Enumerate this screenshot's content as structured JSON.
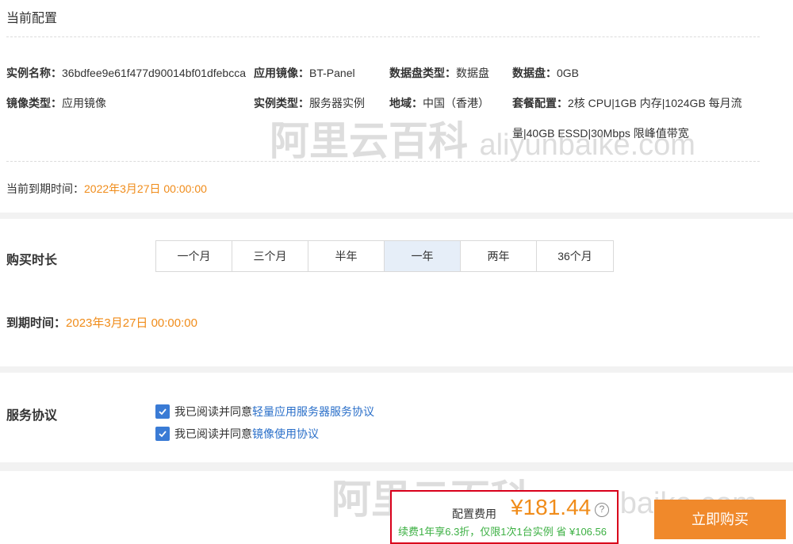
{
  "current_config": {
    "title": "当前配置",
    "instance_name_label": "实例名称：",
    "instance_name_value": "36bdfee9e61f477d90014bf01dfebcca",
    "app_image_label": "应用镜像：",
    "app_image_value": "BT-Panel",
    "disk_type_label": "数据盘类型：",
    "disk_type_value": "数据盘",
    "data_disk_label": "数据盘：",
    "data_disk_value": "0GB",
    "image_type_label": "镜像类型：",
    "image_type_value": "应用镜像",
    "instance_type_label": "实例类型：",
    "instance_type_value": "服务器实例",
    "region_label": "地域：",
    "region_value": "中国（香港）",
    "package_label": "套餐配置：",
    "package_value_line1": "2核 CPU|1GB 内存|1024GB 每月流",
    "package_value_line2": "量|40GB ESSD|30Mbps 限峰值带宽",
    "expire_label": "当前到期时间：",
    "expire_value": "2022年3月27日 00:00:00"
  },
  "duration": {
    "title": "购买时长",
    "options": [
      "一个月",
      "三个月",
      "半年",
      "一年",
      "两年",
      "36个月"
    ],
    "selected": "一年",
    "expire_label": "到期时间：",
    "expire_value": "2023年3月27日 00:00:00"
  },
  "agreement": {
    "title": "服务协议",
    "prefix": "我已阅读并同意",
    "link1": "轻量应用服务器服务协议",
    "link2": "镜像使用协议",
    "checked1": true,
    "checked2": true
  },
  "footer": {
    "price_label": "配置费用",
    "price_value": "¥181.44",
    "discount_text": "续费1年享6.3折，仅限1次1台实例  省 ¥106.56",
    "buy_label": "立即购买"
  },
  "watermark": {
    "cn": "阿里云百科",
    "en": "aliyunbaike.com"
  },
  "colors": {
    "accent_orange": "#f08c1a",
    "link_blue": "#2a6fc9",
    "checkbox_blue": "#3a7bd5",
    "discount_green": "#3cb043",
    "highlight_red": "#d9001b",
    "selected_bg": "#e6eef8"
  }
}
